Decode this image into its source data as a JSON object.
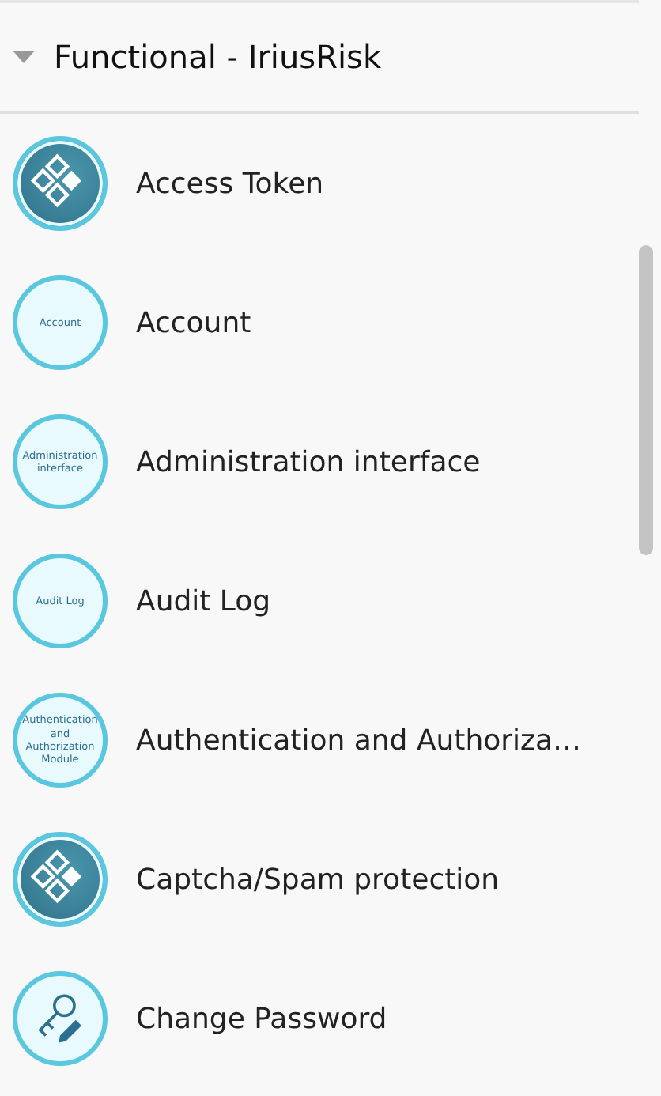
{
  "section": {
    "title": "Functional - IriusRisk",
    "expanded": true
  },
  "items": [
    {
      "label": "Access Token",
      "icon": {
        "kind": "shapes"
      }
    },
    {
      "label": "Account",
      "icon": {
        "kind": "text",
        "text": "Account"
      }
    },
    {
      "label": "Administration interface",
      "icon": {
        "kind": "text",
        "text": "Administration interface"
      }
    },
    {
      "label": "Audit Log",
      "icon": {
        "kind": "text",
        "text": "Audit Log"
      }
    },
    {
      "label": "Authentication and Authoriza…",
      "icon": {
        "kind": "text",
        "text": "Authentication and Authorization Module"
      }
    },
    {
      "label": "Captcha/Spam protection",
      "icon": {
        "kind": "shapes"
      }
    },
    {
      "label": "Change Password",
      "icon": {
        "kind": "key"
      }
    }
  ]
}
